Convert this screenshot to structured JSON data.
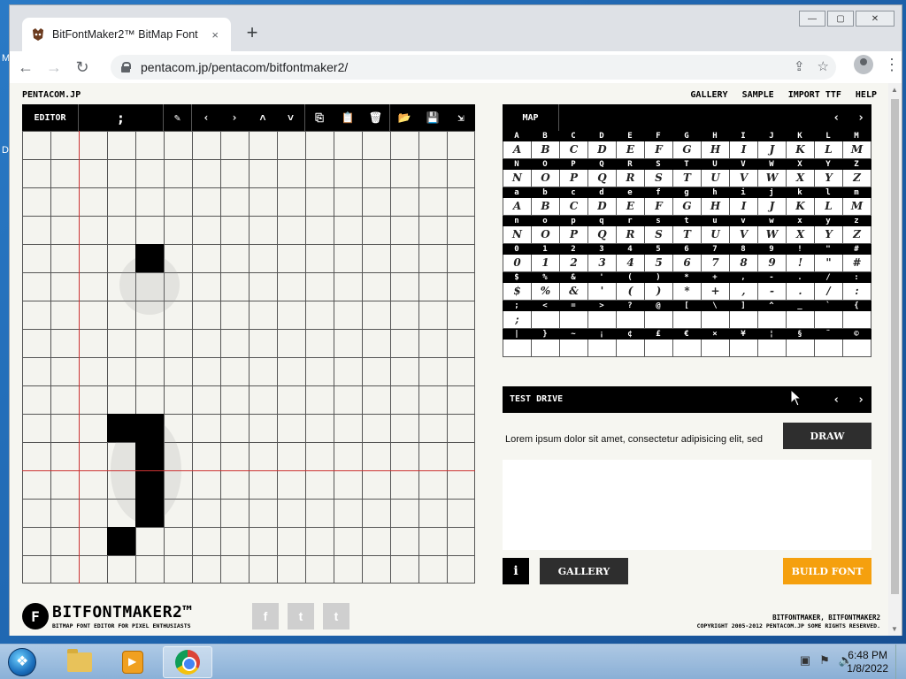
{
  "browser": {
    "tab_title": "BitFontMaker2™ BitMap Font Edi",
    "tab_close": "×",
    "new_tab": "+",
    "url": "pentacom.jp/pentacom/bitfontmaker2/",
    "back": "←",
    "forward": "→",
    "reload": "↻",
    "share": "⇪",
    "star": "☆",
    "menu": "⋮",
    "minimize": "—",
    "maximize": "▢",
    "close": "✕"
  },
  "page": {
    "brand": "PENTACOM.JP",
    "nav": [
      "GALLERY",
      "SAMPLE",
      "IMPORT TTF",
      "HELP"
    ]
  },
  "editor": {
    "label": "EDITOR",
    "current_char": ";",
    "icons": [
      "wand-icon",
      "prev-icon",
      "next-icon",
      "up-icon",
      "down-icon",
      "copy-icon",
      "paste-icon",
      "trash-icon",
      "open-icon",
      "save-icon",
      "export-icon"
    ],
    "icon_glyphs": [
      "✎",
      "‹",
      "›",
      "˄",
      "˅",
      "⎘",
      "📋",
      "🗑",
      "📂",
      "💾",
      "⇲"
    ]
  },
  "map": {
    "label": "MAP",
    "prev": "‹",
    "next": "›",
    "rows": [
      {
        "headers": [
          "A",
          "B",
          "C",
          "D",
          "E",
          "F",
          "G",
          "H",
          "I",
          "J",
          "K",
          "L",
          "M"
        ],
        "glyphs": [
          "A",
          "B",
          "C",
          "D",
          "E",
          "F",
          "G",
          "H",
          "I",
          "J",
          "K",
          "L",
          "M"
        ]
      },
      {
        "headers": [
          "N",
          "O",
          "P",
          "Q",
          "R",
          "S",
          "T",
          "U",
          "V",
          "W",
          "X",
          "Y",
          "Z"
        ],
        "glyphs": [
          "N",
          "O",
          "P",
          "Q",
          "R",
          "S",
          "T",
          "U",
          "V",
          "W",
          "X",
          "Y",
          "Z"
        ]
      },
      {
        "headers": [
          "a",
          "b",
          "c",
          "d",
          "e",
          "f",
          "g",
          "h",
          "i",
          "j",
          "k",
          "l",
          "m"
        ],
        "glyphs": [
          "A",
          "B",
          "C",
          "D",
          "E",
          "F",
          "G",
          "H",
          "I",
          "J",
          "K",
          "L",
          "M"
        ]
      },
      {
        "headers": [
          "n",
          "o",
          "p",
          "q",
          "r",
          "s",
          "t",
          "u",
          "v",
          "w",
          "x",
          "y",
          "z"
        ],
        "glyphs": [
          "N",
          "O",
          "P",
          "Q",
          "R",
          "S",
          "T",
          "U",
          "V",
          "W",
          "X",
          "Y",
          "Z"
        ]
      },
      {
        "headers": [
          "0",
          "1",
          "2",
          "3",
          "4",
          "5",
          "6",
          "7",
          "8",
          "9",
          "!",
          "\"",
          "#"
        ],
        "glyphs": [
          "0",
          "1",
          "2",
          "3",
          "4",
          "5",
          "6",
          "7",
          "8",
          "9",
          "!",
          "\"",
          "#"
        ]
      },
      {
        "headers": [
          "$",
          "%",
          "&",
          "'",
          "(",
          ")",
          "*",
          "+",
          ",",
          "-",
          ".",
          "/",
          ":"
        ],
        "glyphs": [
          "$",
          "%",
          "&",
          "'",
          "(",
          ")",
          "*",
          "+",
          ",",
          "-",
          ".",
          "/",
          ":"
        ]
      },
      {
        "headers": [
          ";",
          "<",
          "=",
          ">",
          "?",
          "@",
          "[",
          "\\",
          "]",
          "^",
          "_",
          "`",
          "{"
        ],
        "glyphs": [
          ";",
          "",
          "",
          "",
          "",
          "",
          "",
          "",
          "",
          "",
          "",
          "",
          ""
        ]
      },
      {
        "headers": [
          "|",
          "}",
          "~",
          "¡",
          "¢",
          "£",
          "€",
          "×",
          "¥",
          "¦",
          "§",
          "¨",
          "©"
        ],
        "glyphs": [
          "",
          "",
          "",
          "",
          "",
          "",
          "",
          "",
          "",
          "",
          "",
          "",
          ""
        ]
      }
    ]
  },
  "test_drive": {
    "label": "TEST DRIVE",
    "prev": "‹",
    "next": "›",
    "text": "Lorem ipsum dolor sit amet, consectetur adipisicing elit, sed",
    "draw": "DRAW"
  },
  "actions": {
    "info": "i",
    "gallery": "GALLERY",
    "build": "BUILD FONT"
  },
  "footer": {
    "logo_letter": "F",
    "logo_name": "BITFONTMAKER2™",
    "logo_tag": "BITMAP FONT EDITOR FOR PIXEL ENTHUSIASTS",
    "social": [
      "f",
      "t",
      "t"
    ],
    "copyright_1": "BITFONTMAKER, BITFONTMAKER2",
    "copyright_2": "COPYRIGHT 2005-2012 PENTACOM.JP SOME RIGHTS RESERVED."
  },
  "taskbar": {
    "time": "6:48 PM",
    "date": "1/8/2022"
  },
  "desktop": {
    "glyph_1": "M",
    "glyph_2": "D"
  },
  "colors": {
    "build_button": "#f5a00e",
    "guide_line": "#cc3333"
  }
}
